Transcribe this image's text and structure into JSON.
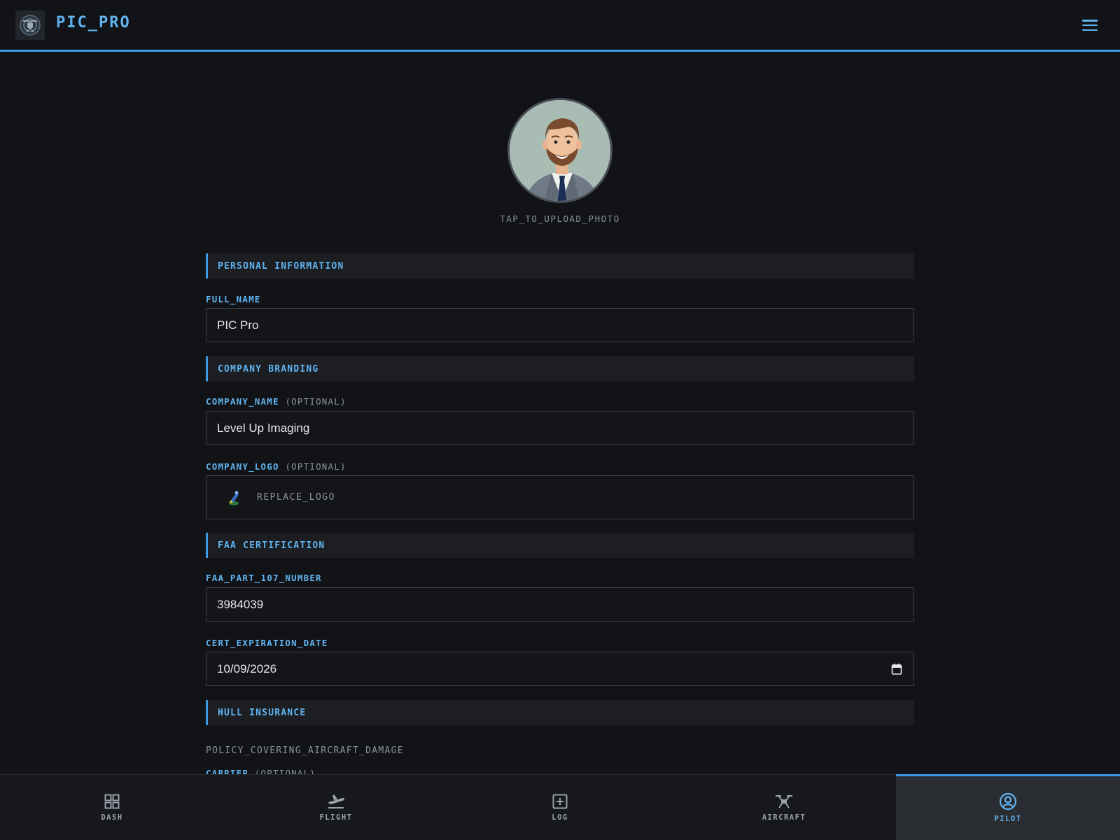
{
  "header": {
    "app_title": "PIC_PRO",
    "logo_icon": "drone-icon",
    "menu_icon": "hamburger-icon"
  },
  "profile": {
    "upload_label": "TAP_TO_UPLOAD_PHOTO"
  },
  "sections": {
    "personal": "PERSONAL INFORMATION",
    "company": "COMPANY BRANDING",
    "faa": "FAA CERTIFICATION",
    "insurance": "HULL INSURANCE"
  },
  "fields": {
    "full_name": {
      "label": "FULL_NAME",
      "value": "PIC Pro"
    },
    "company_name": {
      "label": "COMPANY_NAME",
      "optional": "(OPTIONAL)",
      "value": "Level Up Imaging"
    },
    "company_logo": {
      "label": "COMPANY_LOGO",
      "optional": "(OPTIONAL)",
      "action": "REPLACE_LOGO"
    },
    "faa_number": {
      "label": "FAA_PART_107_NUMBER",
      "value": "3984039"
    },
    "cert_expiration": {
      "label": "CERT_EXPIRATION_DATE",
      "value": "10/09/2026"
    },
    "insurance_desc": "POLICY_COVERING_AIRCRAFT_DAMAGE",
    "carrier": {
      "label": "CARRIER",
      "optional": "(OPTIONAL)"
    }
  },
  "nav": {
    "items": [
      {
        "label": "DASH",
        "icon": "grid-icon"
      },
      {
        "label": "FLIGHT",
        "icon": "plane-takeoff-icon"
      },
      {
        "label": "LOG",
        "icon": "plus-square-icon"
      },
      {
        "label": "AIRCRAFT",
        "icon": "drone-icon"
      },
      {
        "label": "PILOT",
        "icon": "user-circle-icon"
      }
    ],
    "active": "PILOT"
  },
  "colors": {
    "accent": "#3b9be6",
    "accent_text": "#5fb3f0",
    "background": "#121316",
    "muted": "#8b929b"
  }
}
